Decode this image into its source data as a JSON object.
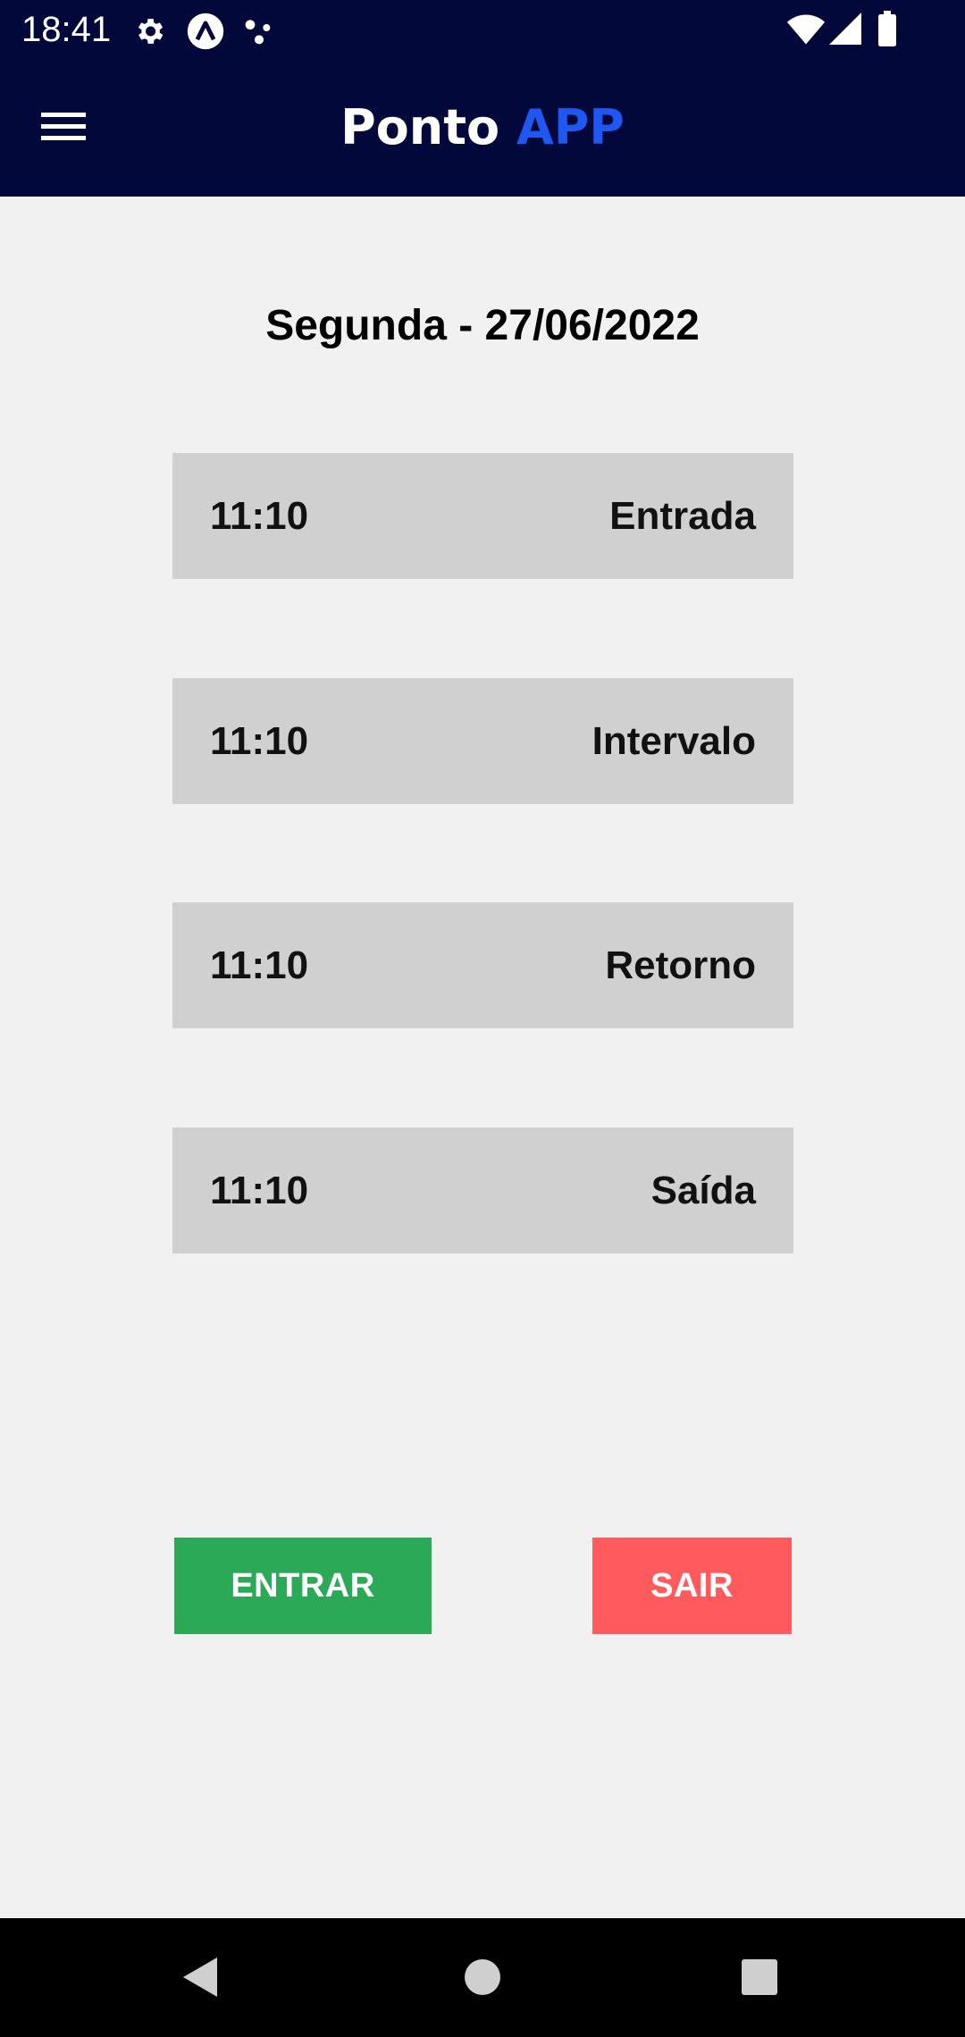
{
  "status_bar": {
    "time": "18:41",
    "left_icons": [
      "gear-icon",
      "app-logo-icon",
      "dots-icon"
    ],
    "right_icons": [
      "wifi-icon",
      "signal-icon",
      "battery-icon"
    ]
  },
  "header": {
    "menu_icon": "hamburger-menu-icon",
    "title_main": "Ponto",
    "title_accent": "APP",
    "background_color": "#02083a",
    "accent_color": "#1f57f0"
  },
  "main": {
    "date": "Segunda - 27/06/2022",
    "records": [
      {
        "time": "11:10",
        "label": "Entrada"
      },
      {
        "time": "11:10",
        "label": "Intervalo"
      },
      {
        "time": "11:10",
        "label": "Retorno"
      },
      {
        "time": "11:10",
        "label": "Saída"
      }
    ]
  },
  "actions": {
    "enter_label": "ENTRAR",
    "enter_color": "#2ba957",
    "exit_label": "SAIR",
    "exit_color": "#ff5b5f"
  },
  "nav_bar": {
    "icons": [
      "back-icon",
      "home-icon",
      "recents-icon"
    ]
  }
}
